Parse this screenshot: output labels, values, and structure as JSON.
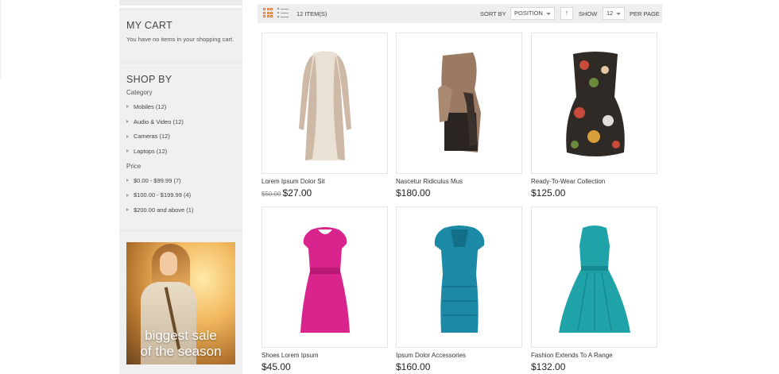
{
  "sidebar": {
    "cart": {
      "title": "MY CART",
      "empty_message": "You have no items in your shopping cart."
    },
    "shop_by": {
      "title": "SHOP BY",
      "category_heading": "Category",
      "categories": [
        {
          "label": "Mobiles (12)"
        },
        {
          "label": "Audio & Video (12)"
        },
        {
          "label": "Cameras (12)"
        },
        {
          "label": "Laptops (12)"
        }
      ],
      "price_heading": "Price",
      "prices": [
        {
          "label": "$0.00 - $99.99 (7)"
        },
        {
          "label": "$100.00 - $199.99 (4)"
        },
        {
          "label": "$200.00 and above (1)"
        }
      ]
    },
    "promo": {
      "line1": "biggest sale",
      "line2": "of the season"
    }
  },
  "toolbar": {
    "item_count": "12 ITEM(S)",
    "sort_by_label": "SORT BY",
    "sort_value": "POSITION",
    "direction_icon": "↑",
    "show_label": "SHOW",
    "show_value": "12",
    "per_page_label": "PER PAGE"
  },
  "products": [
    {
      "name": "Lorem Ipsum Dolor Sit",
      "old_price": "$50.00",
      "price": "$27.00",
      "colors": [
        "#cdb9a6",
        "#e9e2d4"
      ]
    },
    {
      "name": "Nascetur Ridiculus Mus",
      "old_price": "",
      "price": "$180.00",
      "colors": [
        "#9a7a63",
        "#2a2422"
      ]
    },
    {
      "name": "Ready-To-Wear Collection",
      "old_price": "",
      "price": "$125.00",
      "colors": [
        "#2f2a26",
        "#c84a3a"
      ]
    },
    {
      "name": "Shoes Lorem Ipsum",
      "old_price": "",
      "price": "$45.00",
      "colors": [
        "#d8248c",
        "#b81a74"
      ]
    },
    {
      "name": "Ipsum Dolor Accessories",
      "old_price": "",
      "price": "$160.00",
      "colors": [
        "#1c8aa6",
        "#136f88"
      ]
    },
    {
      "name": "Fashion Extends To A Range",
      "old_price": "",
      "price": "$132.00",
      "colors": [
        "#1fa3a8",
        "#168a8f"
      ]
    }
  ]
}
